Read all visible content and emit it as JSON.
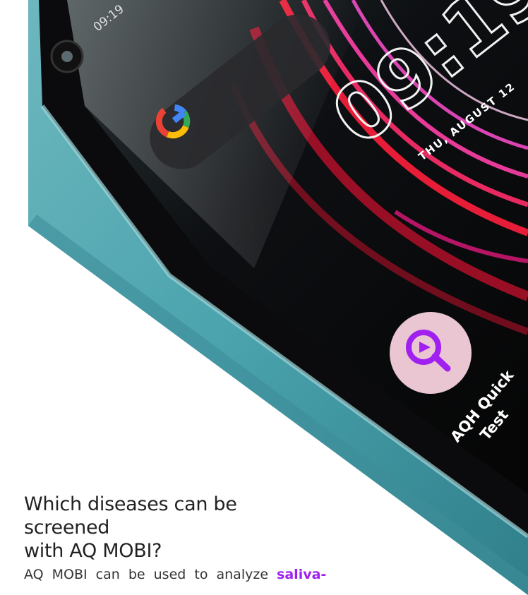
{
  "phone": {
    "status_time": "09:19",
    "clock": "09:19",
    "date": "THU, AUGUST 12",
    "app_label_line1": "AQH Quick",
    "app_label_line2": "Test"
  },
  "article": {
    "heading_line1": "Which diseases can be screened",
    "heading_line2": "with AQ MOBI?",
    "body_prefix": "AQ MOBI can be used to analyze ",
    "body_highlight": "saliva-"
  },
  "colors": {
    "highlight": "#a020f0",
    "background": "#ffffff"
  },
  "icons": {
    "google": "google-g-logo",
    "app": "magnifier-drop-icon"
  }
}
